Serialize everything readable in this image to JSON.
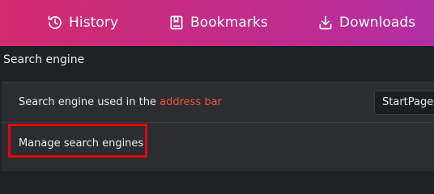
{
  "nav": {
    "items": [
      {
        "label": "History",
        "icon": "history-icon"
      },
      {
        "label": "Bookmarks",
        "icon": "bookmark-icon"
      },
      {
        "label": "Downloads",
        "icon": "download-icon"
      }
    ]
  },
  "search_engine": {
    "section_title": "Search engine",
    "row1_prefix": "Search engine used in the ",
    "row1_link": "address bar",
    "selected_engine": "StartPage",
    "manage_label": "Manage search engines"
  },
  "colors": {
    "accent_gradient_start": "#d32a6f",
    "accent_gradient_end": "#b32ea4",
    "link": "#f0513e",
    "highlight": "#e3060d",
    "background": "#1f2124",
    "card": "#2b2d30"
  }
}
